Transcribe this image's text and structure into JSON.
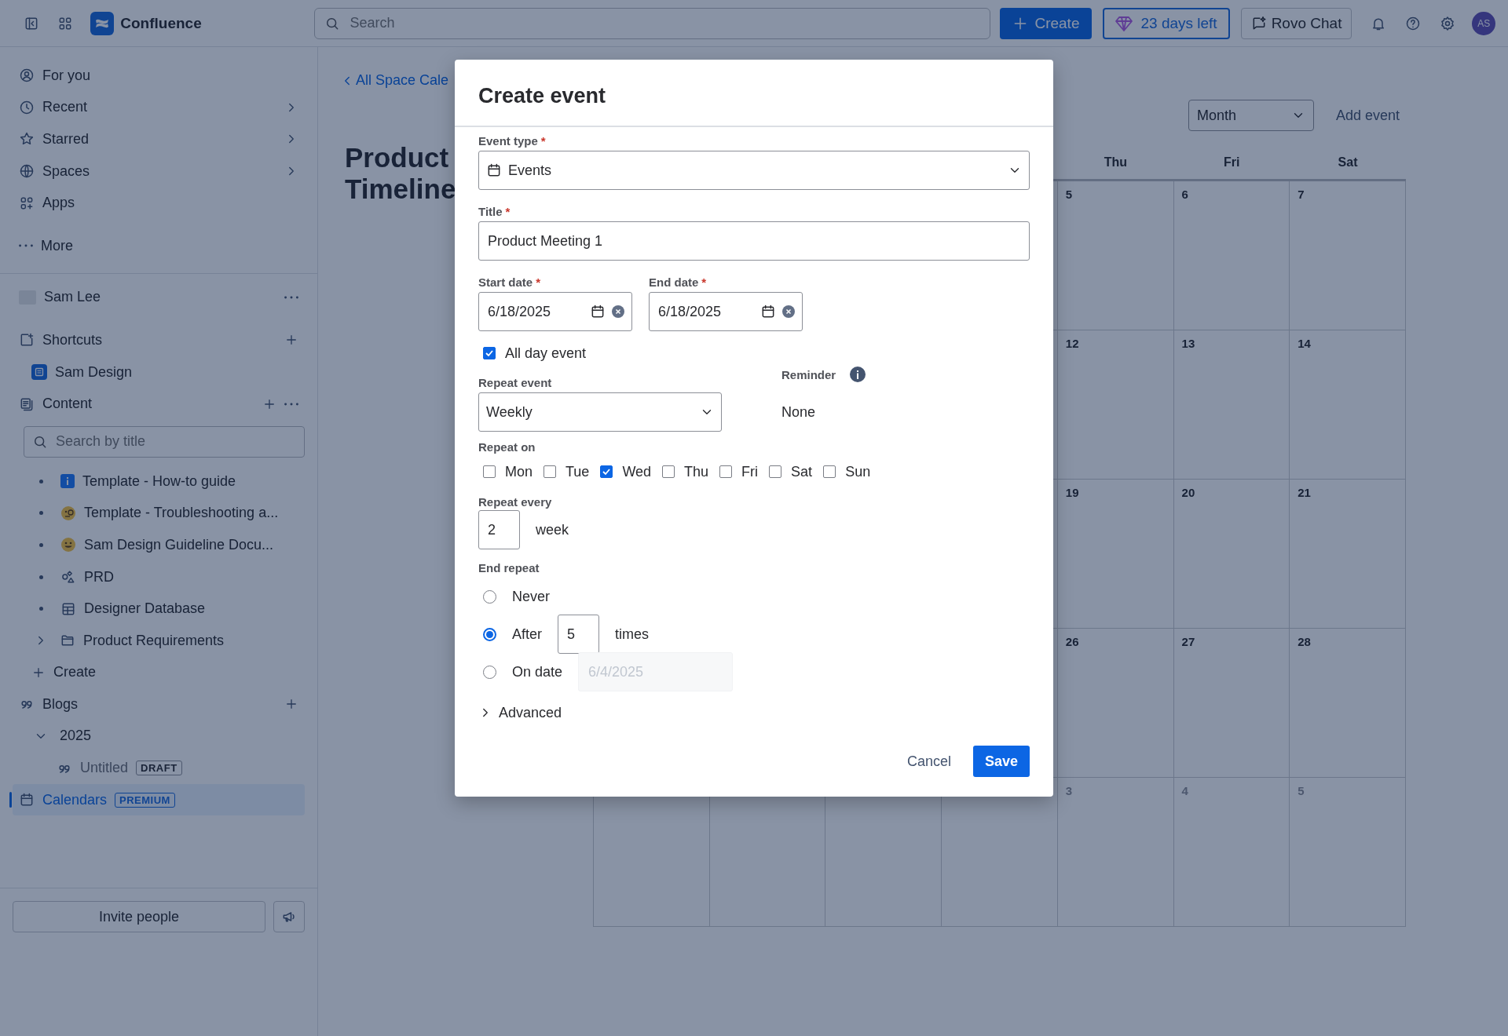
{
  "topbar": {
    "app_name": "Confluence",
    "search": {
      "placeholder": "Search"
    },
    "create": "Create",
    "trial": "23 days left",
    "rovo": "Rovo Chat",
    "avatar": "AS"
  },
  "sidebar": {
    "nav": [
      {
        "label": "For you",
        "kind": "link"
      },
      {
        "label": "Recent",
        "kind": "menu"
      },
      {
        "label": "Starred",
        "kind": "menu"
      },
      {
        "label": "Spaces",
        "kind": "menu"
      },
      {
        "label": "Apps",
        "kind": "link"
      },
      {
        "label": "More",
        "kind": "link"
      }
    ],
    "space": {
      "name": "Sam Lee"
    },
    "shortcuts": {
      "label": "Shortcuts",
      "items": [
        {
          "label": "Sam Design"
        }
      ]
    },
    "content": {
      "label": "Content",
      "search": {
        "placeholder": "Search by title"
      },
      "items": [
        {
          "label": "Template - How-to guide",
          "kind": "page"
        },
        {
          "label": "Template - Troubleshooting a...",
          "kind": "page"
        },
        {
          "label": "Sam Design Guideline Docu...",
          "kind": "page"
        },
        {
          "label": "PRD",
          "kind": "page"
        },
        {
          "label": "Designer Database",
          "kind": "page"
        },
        {
          "label": "Product Requirements",
          "kind": "folder",
          "expanded": false
        }
      ],
      "create": "Create"
    },
    "blogs": {
      "label": "Blogs",
      "children": [
        {
          "label": "2025",
          "expanded": true,
          "children": [
            {
              "label": "Untitled",
              "badge": "DRAFT"
            }
          ]
        }
      ]
    },
    "calendars": {
      "label": "Calendars",
      "badge": "PREMIUM",
      "selected": true
    },
    "invite": "Invite people"
  },
  "main": {
    "breadcrumb": "All Space Cale",
    "title": "Product Timeline",
    "view_select": "Month",
    "add_event": "Add event",
    "calendar": {
      "weekdays": [
        "Thu",
        "Fri",
        "Sat"
      ],
      "weeks": [
        [
          {
            "day": "5",
            "other_month": false
          },
          {
            "day": "6",
            "other_month": false
          },
          {
            "day": "7",
            "other_month": false
          }
        ],
        [
          {
            "day": "12",
            "other_month": false
          },
          {
            "day": "13",
            "other_month": false
          },
          {
            "day": "14",
            "other_month": false
          }
        ],
        [
          {
            "day": "19",
            "other_month": false
          },
          {
            "day": "20",
            "other_month": false
          },
          {
            "day": "21",
            "other_month": false
          }
        ],
        [
          {
            "day": "26",
            "other_month": false
          },
          {
            "day": "27",
            "other_month": false
          },
          {
            "day": "28",
            "other_month": false
          }
        ],
        [
          {
            "day": "3",
            "other_month": true
          },
          {
            "day": "4",
            "other_month": true
          },
          {
            "day": "5",
            "other_month": true
          }
        ]
      ]
    }
  },
  "modal": {
    "title": "Create event",
    "required_mark": "*",
    "event_type": {
      "label": "Event type",
      "value": "Events"
    },
    "title_field": {
      "label": "Title",
      "value": "Product Meeting 1"
    },
    "start_date": {
      "label": "Start date",
      "value": "6/18/2025"
    },
    "end_date": {
      "label": "End date",
      "value": "6/18/2025"
    },
    "all_day": {
      "label": "All day event",
      "checked": true
    },
    "repeat_event": {
      "label": "Repeat event",
      "value": "Weekly"
    },
    "reminder": {
      "label": "Reminder",
      "value": "None"
    },
    "repeat_on": {
      "label": "Repeat on",
      "days": [
        {
          "label": "Mon",
          "checked": false
        },
        {
          "label": "Tue",
          "checked": false
        },
        {
          "label": "Wed",
          "checked": true
        },
        {
          "label": "Thu",
          "checked": false
        },
        {
          "label": "Fri",
          "checked": false
        },
        {
          "label": "Sat",
          "checked": false
        },
        {
          "label": "Sun",
          "checked": false
        }
      ]
    },
    "repeat_every": {
      "label": "Repeat every",
      "value": "2",
      "unit": "week"
    },
    "end_repeat": {
      "label": "End repeat",
      "options": [
        {
          "label": "Never",
          "selected": false
        },
        {
          "label": "After",
          "selected": true,
          "value": "5",
          "suffix": "times"
        },
        {
          "label": "On date",
          "selected": false,
          "placeholder": "6/4/2025",
          "disabled": true
        }
      ]
    },
    "advanced": {
      "label": "Advanced",
      "expanded": false
    },
    "cancel": "Cancel",
    "save": "Save"
  }
}
